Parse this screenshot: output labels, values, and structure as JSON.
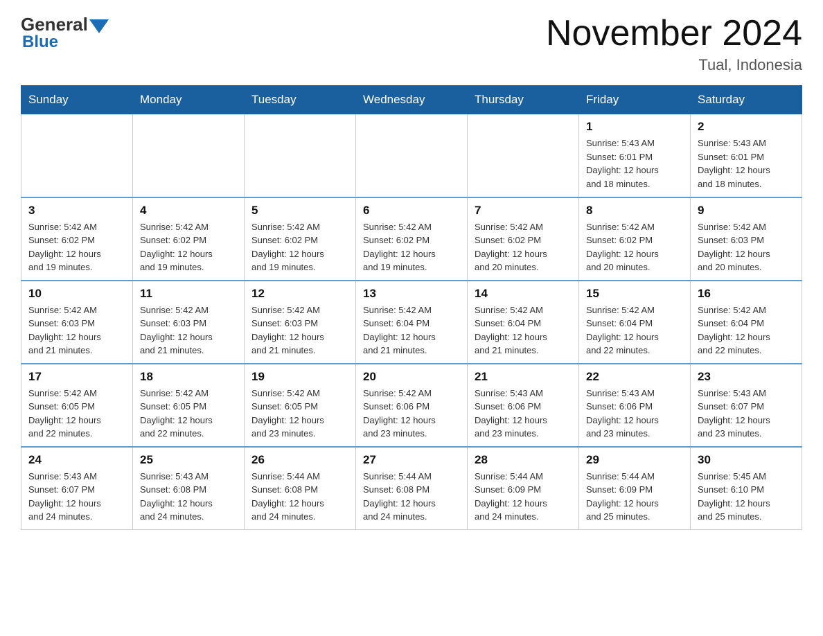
{
  "logo": {
    "text_general": "General",
    "text_blue": "Blue"
  },
  "header": {
    "title": "November 2024",
    "subtitle": "Tual, Indonesia"
  },
  "weekdays": [
    "Sunday",
    "Monday",
    "Tuesday",
    "Wednesday",
    "Thursday",
    "Friday",
    "Saturday"
  ],
  "weeks": [
    [
      {
        "day": "",
        "info": ""
      },
      {
        "day": "",
        "info": ""
      },
      {
        "day": "",
        "info": ""
      },
      {
        "day": "",
        "info": ""
      },
      {
        "day": "",
        "info": ""
      },
      {
        "day": "1",
        "info": "Sunrise: 5:43 AM\nSunset: 6:01 PM\nDaylight: 12 hours\nand 18 minutes."
      },
      {
        "day": "2",
        "info": "Sunrise: 5:43 AM\nSunset: 6:01 PM\nDaylight: 12 hours\nand 18 minutes."
      }
    ],
    [
      {
        "day": "3",
        "info": "Sunrise: 5:42 AM\nSunset: 6:02 PM\nDaylight: 12 hours\nand 19 minutes."
      },
      {
        "day": "4",
        "info": "Sunrise: 5:42 AM\nSunset: 6:02 PM\nDaylight: 12 hours\nand 19 minutes."
      },
      {
        "day": "5",
        "info": "Sunrise: 5:42 AM\nSunset: 6:02 PM\nDaylight: 12 hours\nand 19 minutes."
      },
      {
        "day": "6",
        "info": "Sunrise: 5:42 AM\nSunset: 6:02 PM\nDaylight: 12 hours\nand 19 minutes."
      },
      {
        "day": "7",
        "info": "Sunrise: 5:42 AM\nSunset: 6:02 PM\nDaylight: 12 hours\nand 20 minutes."
      },
      {
        "day": "8",
        "info": "Sunrise: 5:42 AM\nSunset: 6:02 PM\nDaylight: 12 hours\nand 20 minutes."
      },
      {
        "day": "9",
        "info": "Sunrise: 5:42 AM\nSunset: 6:03 PM\nDaylight: 12 hours\nand 20 minutes."
      }
    ],
    [
      {
        "day": "10",
        "info": "Sunrise: 5:42 AM\nSunset: 6:03 PM\nDaylight: 12 hours\nand 21 minutes."
      },
      {
        "day": "11",
        "info": "Sunrise: 5:42 AM\nSunset: 6:03 PM\nDaylight: 12 hours\nand 21 minutes."
      },
      {
        "day": "12",
        "info": "Sunrise: 5:42 AM\nSunset: 6:03 PM\nDaylight: 12 hours\nand 21 minutes."
      },
      {
        "day": "13",
        "info": "Sunrise: 5:42 AM\nSunset: 6:04 PM\nDaylight: 12 hours\nand 21 minutes."
      },
      {
        "day": "14",
        "info": "Sunrise: 5:42 AM\nSunset: 6:04 PM\nDaylight: 12 hours\nand 21 minutes."
      },
      {
        "day": "15",
        "info": "Sunrise: 5:42 AM\nSunset: 6:04 PM\nDaylight: 12 hours\nand 22 minutes."
      },
      {
        "day": "16",
        "info": "Sunrise: 5:42 AM\nSunset: 6:04 PM\nDaylight: 12 hours\nand 22 minutes."
      }
    ],
    [
      {
        "day": "17",
        "info": "Sunrise: 5:42 AM\nSunset: 6:05 PM\nDaylight: 12 hours\nand 22 minutes."
      },
      {
        "day": "18",
        "info": "Sunrise: 5:42 AM\nSunset: 6:05 PM\nDaylight: 12 hours\nand 22 minutes."
      },
      {
        "day": "19",
        "info": "Sunrise: 5:42 AM\nSunset: 6:05 PM\nDaylight: 12 hours\nand 23 minutes."
      },
      {
        "day": "20",
        "info": "Sunrise: 5:42 AM\nSunset: 6:06 PM\nDaylight: 12 hours\nand 23 minutes."
      },
      {
        "day": "21",
        "info": "Sunrise: 5:43 AM\nSunset: 6:06 PM\nDaylight: 12 hours\nand 23 minutes."
      },
      {
        "day": "22",
        "info": "Sunrise: 5:43 AM\nSunset: 6:06 PM\nDaylight: 12 hours\nand 23 minutes."
      },
      {
        "day": "23",
        "info": "Sunrise: 5:43 AM\nSunset: 6:07 PM\nDaylight: 12 hours\nand 23 minutes."
      }
    ],
    [
      {
        "day": "24",
        "info": "Sunrise: 5:43 AM\nSunset: 6:07 PM\nDaylight: 12 hours\nand 24 minutes."
      },
      {
        "day": "25",
        "info": "Sunrise: 5:43 AM\nSunset: 6:08 PM\nDaylight: 12 hours\nand 24 minutes."
      },
      {
        "day": "26",
        "info": "Sunrise: 5:44 AM\nSunset: 6:08 PM\nDaylight: 12 hours\nand 24 minutes."
      },
      {
        "day": "27",
        "info": "Sunrise: 5:44 AM\nSunset: 6:08 PM\nDaylight: 12 hours\nand 24 minutes."
      },
      {
        "day": "28",
        "info": "Sunrise: 5:44 AM\nSunset: 6:09 PM\nDaylight: 12 hours\nand 24 minutes."
      },
      {
        "day": "29",
        "info": "Sunrise: 5:44 AM\nSunset: 6:09 PM\nDaylight: 12 hours\nand 25 minutes."
      },
      {
        "day": "30",
        "info": "Sunrise: 5:45 AM\nSunset: 6:10 PM\nDaylight: 12 hours\nand 25 minutes."
      }
    ]
  ]
}
